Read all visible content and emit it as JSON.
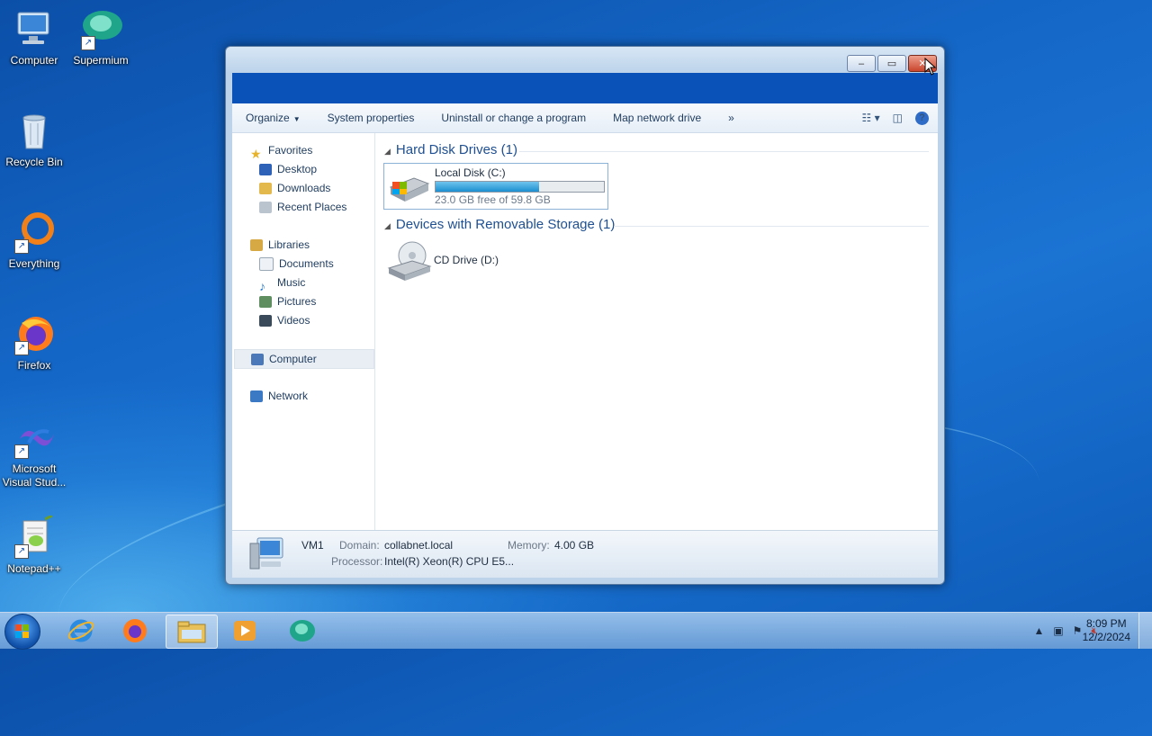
{
  "desktop": {
    "icons": [
      {
        "label": "Computer"
      },
      {
        "label": "Supermium"
      },
      {
        "label": "Recycle Bin"
      },
      {
        "label": "Everything"
      },
      {
        "label": "Firefox"
      },
      {
        "label": "Microsoft Visual Stud..."
      },
      {
        "label": "Notepad++"
      }
    ]
  },
  "window": {
    "controls": {
      "minimize": "–",
      "maximize": "▭",
      "close": "✕"
    },
    "commands": {
      "organize": "Organize",
      "system_properties": "System properties",
      "uninstall": "Uninstall or change a program",
      "map_drive": "Map network drive",
      "more": "»"
    },
    "nav": {
      "favorites": "Favorites",
      "desktop": "Desktop",
      "downloads": "Downloads",
      "recent": "Recent Places",
      "libraries": "Libraries",
      "documents": "Documents",
      "music": "Music",
      "pictures": "Pictures",
      "videos": "Videos",
      "computer": "Computer",
      "network": "Network"
    },
    "groups": {
      "hdd": "Hard Disk Drives (1)",
      "removable": "Devices with Removable Storage (1)"
    },
    "drives": {
      "c_name": "Local Disk (C:)",
      "c_free": "23.0 GB free of 59.8 GB",
      "c_used_fraction": 0.615,
      "d_name": "CD Drive (D:)"
    },
    "details": {
      "name": "VM1",
      "domain_label": "Domain:",
      "domain": "collabnet.local",
      "memory_label": "Memory:",
      "memory": "4.00 GB",
      "processor_label": "Processor:",
      "processor": "Intel(R) Xeon(R) CPU E5..."
    }
  },
  "taskbar": {
    "clock_time": "8:09 PM",
    "clock_date": "12/2/2024"
  },
  "colors": {
    "accent": "#1e4f91",
    "address_bar": "#0a52b7"
  }
}
